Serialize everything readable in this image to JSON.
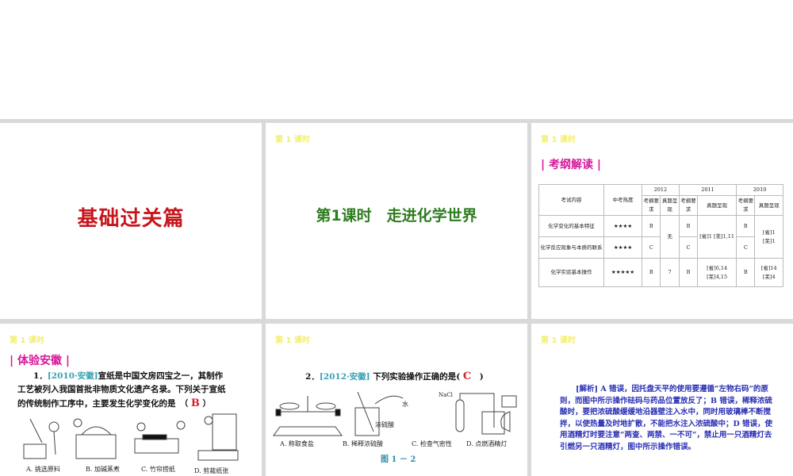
{
  "lesson_label": "第 1 课时",
  "slide1": {
    "title": "基础过关篇",
    "color": "#c8161d"
  },
  "slide2": {
    "title": "第1课时　走进化学世界",
    "color": "#2e7d1f"
  },
  "slide3": {
    "section": "| 考纲解读 |",
    "headers": {
      "content": "考试内容",
      "heat": "中考热度",
      "years": [
        "2012",
        "2011",
        "2010"
      ],
      "req": "考纲要求",
      "real": "真题呈现"
    },
    "rows": [
      {
        "content": "化学变化的基本特征",
        "heat": "★★★★",
        "r2012": "B",
        "r2011": "B",
        "r2010": "B"
      },
      {
        "content": "化学反应现象与本质的联系",
        "heat": "★★★★",
        "r2012": "C",
        "r2011": "C",
        "r2010": "C"
      },
      {
        "content": "化学实验基本操作",
        "heat": "★★★★★",
        "r2012": "B",
        "t2012": "7",
        "r2011": "B",
        "t2011": "[省]6,14 [芜]4,15",
        "r2010": "B",
        "t2010": "[省]14 [芜]4"
      }
    ],
    "merged": {
      "t2012": "无",
      "t2011": "[省]1 [芜]1,11",
      "t2010": "[省]1 [芜]1"
    }
  },
  "slide4": {
    "section": "| 体验安徽 |",
    "num": "1．",
    "source": "[2010·安徽]",
    "text": "宣纸是中国文房四宝之一，其制作工艺被列入我国首批非物质文化遗产名录。下列关于宣纸的传统制作工序中，主要发生化学变化的是",
    "answer": "B",
    "captions": [
      "A. 挑选原料",
      "B. 加碱蒸煮",
      "C. 竹帘捞纸",
      "D. 剪裁纸张"
    ]
  },
  "slide5": {
    "num": "2．",
    "source": "[2012·安徽]",
    "text": "下列实验操作正确的是(",
    "answer": "C",
    "close": ")",
    "labels": {
      "nacl": "NaCl",
      "water": "水",
      "acid": "浓硫酸"
    },
    "captions": [
      "A. 称取食盐",
      "B. 稀释浓硫酸",
      "C. 检查气密性",
      "D. 点燃酒精灯"
    ],
    "figure": "图 1 － 2"
  },
  "slide6": {
    "analysis": "[解析] A 错误，因托盘天平的使用要遵循“左物右码”的原则，而图中所示操作砝码与药品位置放反了；B 错误，稀释浓硫酸时，要把浓硫酸缓缓地沿器壁注入水中，同时用玻璃棒不断搅拌，以使热量及时地扩散，不能把水注入浓硫酸中；D 错误，使用酒精灯时要注意“两查、两禁、一不可”，禁止用一只酒精灯去引燃另一只酒精灯，图中所示操作错误。"
  }
}
